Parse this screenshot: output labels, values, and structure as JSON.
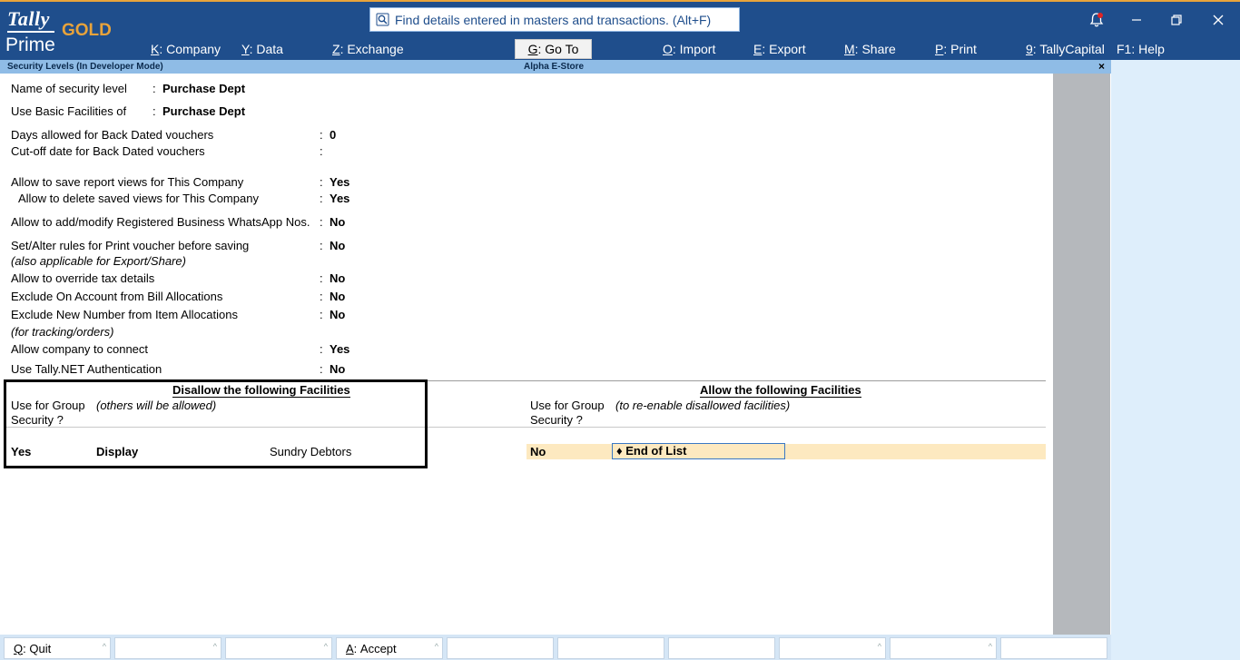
{
  "header": {
    "logo": {
      "tally": "Tally",
      "gold": "GOLD",
      "prime": "Prime"
    },
    "search_placeholder": "Find details entered in masters and transactions. (Alt+F)",
    "menu": [
      {
        "key": "K",
        "label": "Company"
      },
      {
        "key": "Y",
        "label": "Data"
      },
      {
        "key": "Z",
        "label": "Exchange"
      },
      {
        "key": "G",
        "label": "Go To"
      },
      {
        "key": "O",
        "label": "Import"
      },
      {
        "key": "E",
        "label": "Export"
      },
      {
        "key": "M",
        "label": "Share"
      },
      {
        "key": "P",
        "label": "Print"
      },
      {
        "key": "9",
        "label": "TallyCapital"
      },
      {
        "key": "F1",
        "label": "Help"
      }
    ],
    "icons": [
      "search-icon",
      "notification-bell-icon",
      "minimize-icon",
      "restore-icon",
      "close-icon"
    ]
  },
  "window": {
    "title": "Security Levels (In Developer Mode)",
    "company": "Alpha E-Store",
    "close_glyph": "×"
  },
  "form": {
    "name_label": "Name of security level",
    "name_value": "Purchase Dept",
    "basic_label": "Use Basic Facilities of",
    "basic_value": "Purchase Dept",
    "fields": [
      {
        "label": "Days allowed for Back Dated vouchers",
        "value": "0"
      },
      {
        "label": "Cut-off date for Back Dated vouchers",
        "value": ""
      },
      {
        "label": "Allow to save report views for This Company",
        "value": "Yes"
      },
      {
        "label": "Allow to delete saved views for This Company",
        "value": "Yes"
      },
      {
        "label": "Allow to add/modify Registered Business WhatsApp Nos.",
        "value": "No"
      },
      {
        "label": "Set/Alter rules for Print voucher before saving",
        "value": "No",
        "note": "(also applicable for Export/Share)"
      },
      {
        "label": "Allow to override tax details",
        "value": "No"
      },
      {
        "label": "Exclude On Account from Bill Allocations",
        "value": "No"
      },
      {
        "label": "Exclude New Number from Item Allocations",
        "value": "No",
        "note": "(for tracking/orders)"
      },
      {
        "label": "Allow company to connect",
        "value": "Yes"
      },
      {
        "label": "Use Tally.NET Authentication",
        "value": "No"
      }
    ]
  },
  "disallow": {
    "title": "Disallow the following Facilities",
    "group_label_1": "Use for Group",
    "group_label_2": "Security ?",
    "note": "(others will be allowed)",
    "row": {
      "use_group": "Yes",
      "type": "Display",
      "facility": "Sundry Debtors"
    }
  },
  "allow": {
    "title": "Allow the following Facilities",
    "group_label_1": "Use for Group",
    "group_label_2": "Security ?",
    "note": "(to re-enable disallowed facilities)",
    "row": {
      "use_group": "No",
      "end_of_list": "End of List"
    }
  },
  "footer": {
    "buttons": [
      {
        "key": "Q",
        "label": "Quit"
      },
      {
        "key": "",
        "label": ""
      },
      {
        "key": "",
        "label": ""
      },
      {
        "key": "A",
        "label": "Accept"
      },
      {
        "key": "",
        "label": ""
      },
      {
        "key": "",
        "label": ""
      },
      {
        "key": "",
        "label": ""
      },
      {
        "key": "",
        "label": ""
      },
      {
        "key": "",
        "label": ""
      },
      {
        "key": "",
        "label": ""
      }
    ]
  }
}
